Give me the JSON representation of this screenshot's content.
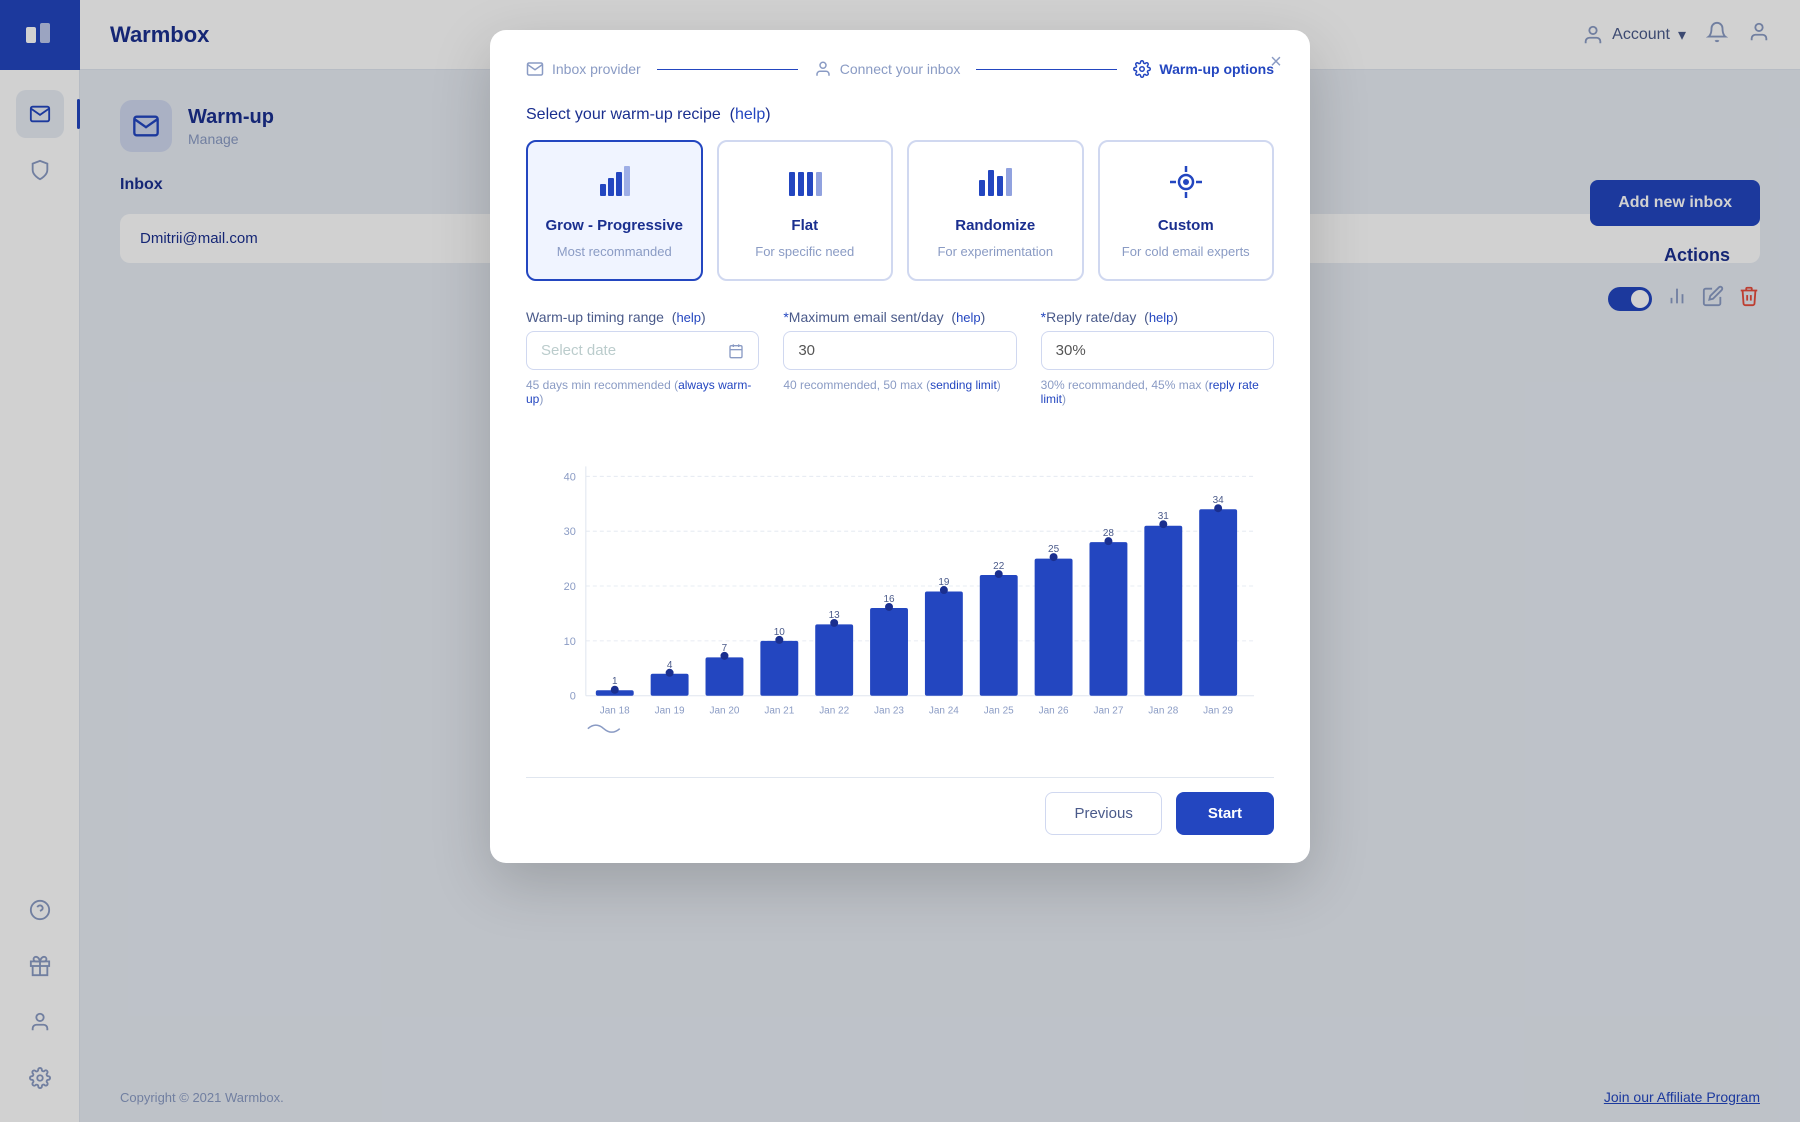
{
  "app": {
    "name": "Warmbox",
    "logo_text": "Warmbox"
  },
  "topbar": {
    "account_label": "Account",
    "account_arrow": "▾"
  },
  "sidebar": {
    "items": [
      {
        "name": "inbox",
        "icon": "inbox",
        "active": true
      },
      {
        "name": "shield",
        "icon": "shield"
      },
      {
        "name": "help",
        "icon": "help"
      },
      {
        "name": "gift",
        "icon": "gift"
      },
      {
        "name": "user",
        "icon": "user"
      },
      {
        "name": "settings",
        "icon": "settings"
      }
    ]
  },
  "page": {
    "title": "Warm-up",
    "subtitle": "Manage",
    "add_inbox_label": "Add new inbox",
    "actions_label": "Actions",
    "inbox_name": "Dmitrii@mail.com",
    "inbox_label": "Inbox",
    "footer_copyright": "Copyright © 2021 Warmbox.",
    "affiliate_label": "Join our Affiliate Program"
  },
  "modal": {
    "close_label": "×",
    "steps": [
      {
        "id": "inbox-provider",
        "label": "Inbox provider",
        "done": true
      },
      {
        "id": "connect-inbox",
        "label": "Connect your inbox",
        "done": true
      },
      {
        "id": "warmup-options",
        "label": "Warm-up options",
        "active": true
      }
    ],
    "section_title": "Select your warm-up recipe",
    "section_help": "help",
    "recipes": [
      {
        "id": "grow",
        "name": "Grow - Progressive",
        "sub": "Most recommanded",
        "selected": true
      },
      {
        "id": "flat",
        "name": "Flat",
        "sub": "For specific need",
        "selected": false
      },
      {
        "id": "randomize",
        "name": "Randomize",
        "sub": "For experimentation",
        "selected": false
      },
      {
        "id": "custom",
        "name": "Custom",
        "sub": "For cold email experts",
        "selected": false
      }
    ],
    "timing_label": "Warm-up timing range",
    "timing_help": "help",
    "timing_placeholder": "Select date",
    "timing_hint": "45 days min recommended (",
    "timing_hint_link": "always warm-up",
    "timing_hint_end": ")",
    "max_email_label": "*Maximum email sent/day",
    "max_email_help": "help",
    "max_email_value": "30",
    "max_email_hint": "40 recommended, 50 max (",
    "max_email_hint_link": "sending limit",
    "max_email_hint_end": ")",
    "reply_rate_label": "*Reply rate/day",
    "reply_rate_help": "help",
    "reply_rate_value": "30%",
    "reply_rate_hint": "30% recommanded, 45% max (",
    "reply_rate_hint_link": "reply rate limit",
    "reply_rate_hint_end": ")",
    "chart": {
      "y_labels": [
        "0",
        "10",
        "20",
        "30",
        "40"
      ],
      "bars": [
        {
          "date": "Jan 18",
          "value": 1
        },
        {
          "date": "Jan 19",
          "value": 4
        },
        {
          "date": "Jan 20",
          "value": 7
        },
        {
          "date": "Jan 21",
          "value": 10
        },
        {
          "date": "Jan 22",
          "value": 13
        },
        {
          "date": "Jan 23",
          "value": 16
        },
        {
          "date": "Jan 24",
          "value": 19
        },
        {
          "date": "Jan 25",
          "value": 22
        },
        {
          "date": "Jan 26",
          "value": 25
        },
        {
          "date": "Jan 27",
          "value": 28
        },
        {
          "date": "Jan 28",
          "value": 31
        },
        {
          "date": "Jan 29",
          "value": 34
        }
      ]
    },
    "previous_label": "Previous",
    "start_label": "Start"
  }
}
